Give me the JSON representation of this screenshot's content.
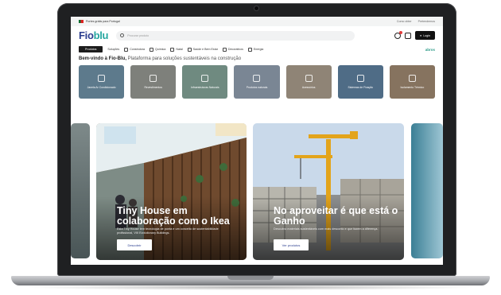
{
  "topbar": {
    "shipping_text": "Portes grátis para Portugal",
    "links": [
      "Como obter",
      "Pretendemos"
    ]
  },
  "header": {
    "logo_main": "Fio",
    "logo_accent": "blu",
    "search_placeholder": "Procurar produto",
    "login_label": "Login"
  },
  "nav": {
    "active_label": "Produtos",
    "items": [
      "Soluções",
      "Construtora",
      "Química",
      "Natal",
      "Saúde e Bem Estar",
      "Decorativos",
      "Energia"
    ],
    "partner_brand": "abros"
  },
  "welcome": {
    "bold": "Bem-vindo à Fio-Blu,",
    "rest": " Plataforma para soluções sustentáveis na construção"
  },
  "categories": [
    {
      "label": "Janela Ar Condicionado",
      "color": "#5d7a8c"
    },
    {
      "label": "Revestimentos",
      "color": "#7e807b"
    },
    {
      "label": "Infraestruturas Naturais",
      "color": "#6f8a80"
    },
    {
      "label": "Produtos naturais",
      "color": "#7a8694"
    },
    {
      "label": "Acessórios",
      "color": "#8f8476"
    },
    {
      "label": "Sistemas de Fixação",
      "color": "#4f6c86"
    },
    {
      "label": "Isolamento Térmico",
      "color": "#86735f"
    }
  ],
  "hero_cards": [
    {
      "title": "Tiny House em colaboração com o Ikea",
      "text": "Esta Tiny House tem tecnologia de ponta e um conceito de sustentabilidade profissional, VIII Evolutionary Buildings.",
      "button": "Descobrir"
    },
    {
      "title": "No aproveitar é que está o Ganho",
      "text": "Descubra materiais sustentáveis com mais desconto e que fazem a diferença.",
      "button": "Ver produtos"
    }
  ],
  "colors": {
    "brand_blue": "#2b3e8f",
    "brand_teal": "#27a7a0",
    "nav_active": "#1c1c1c"
  }
}
